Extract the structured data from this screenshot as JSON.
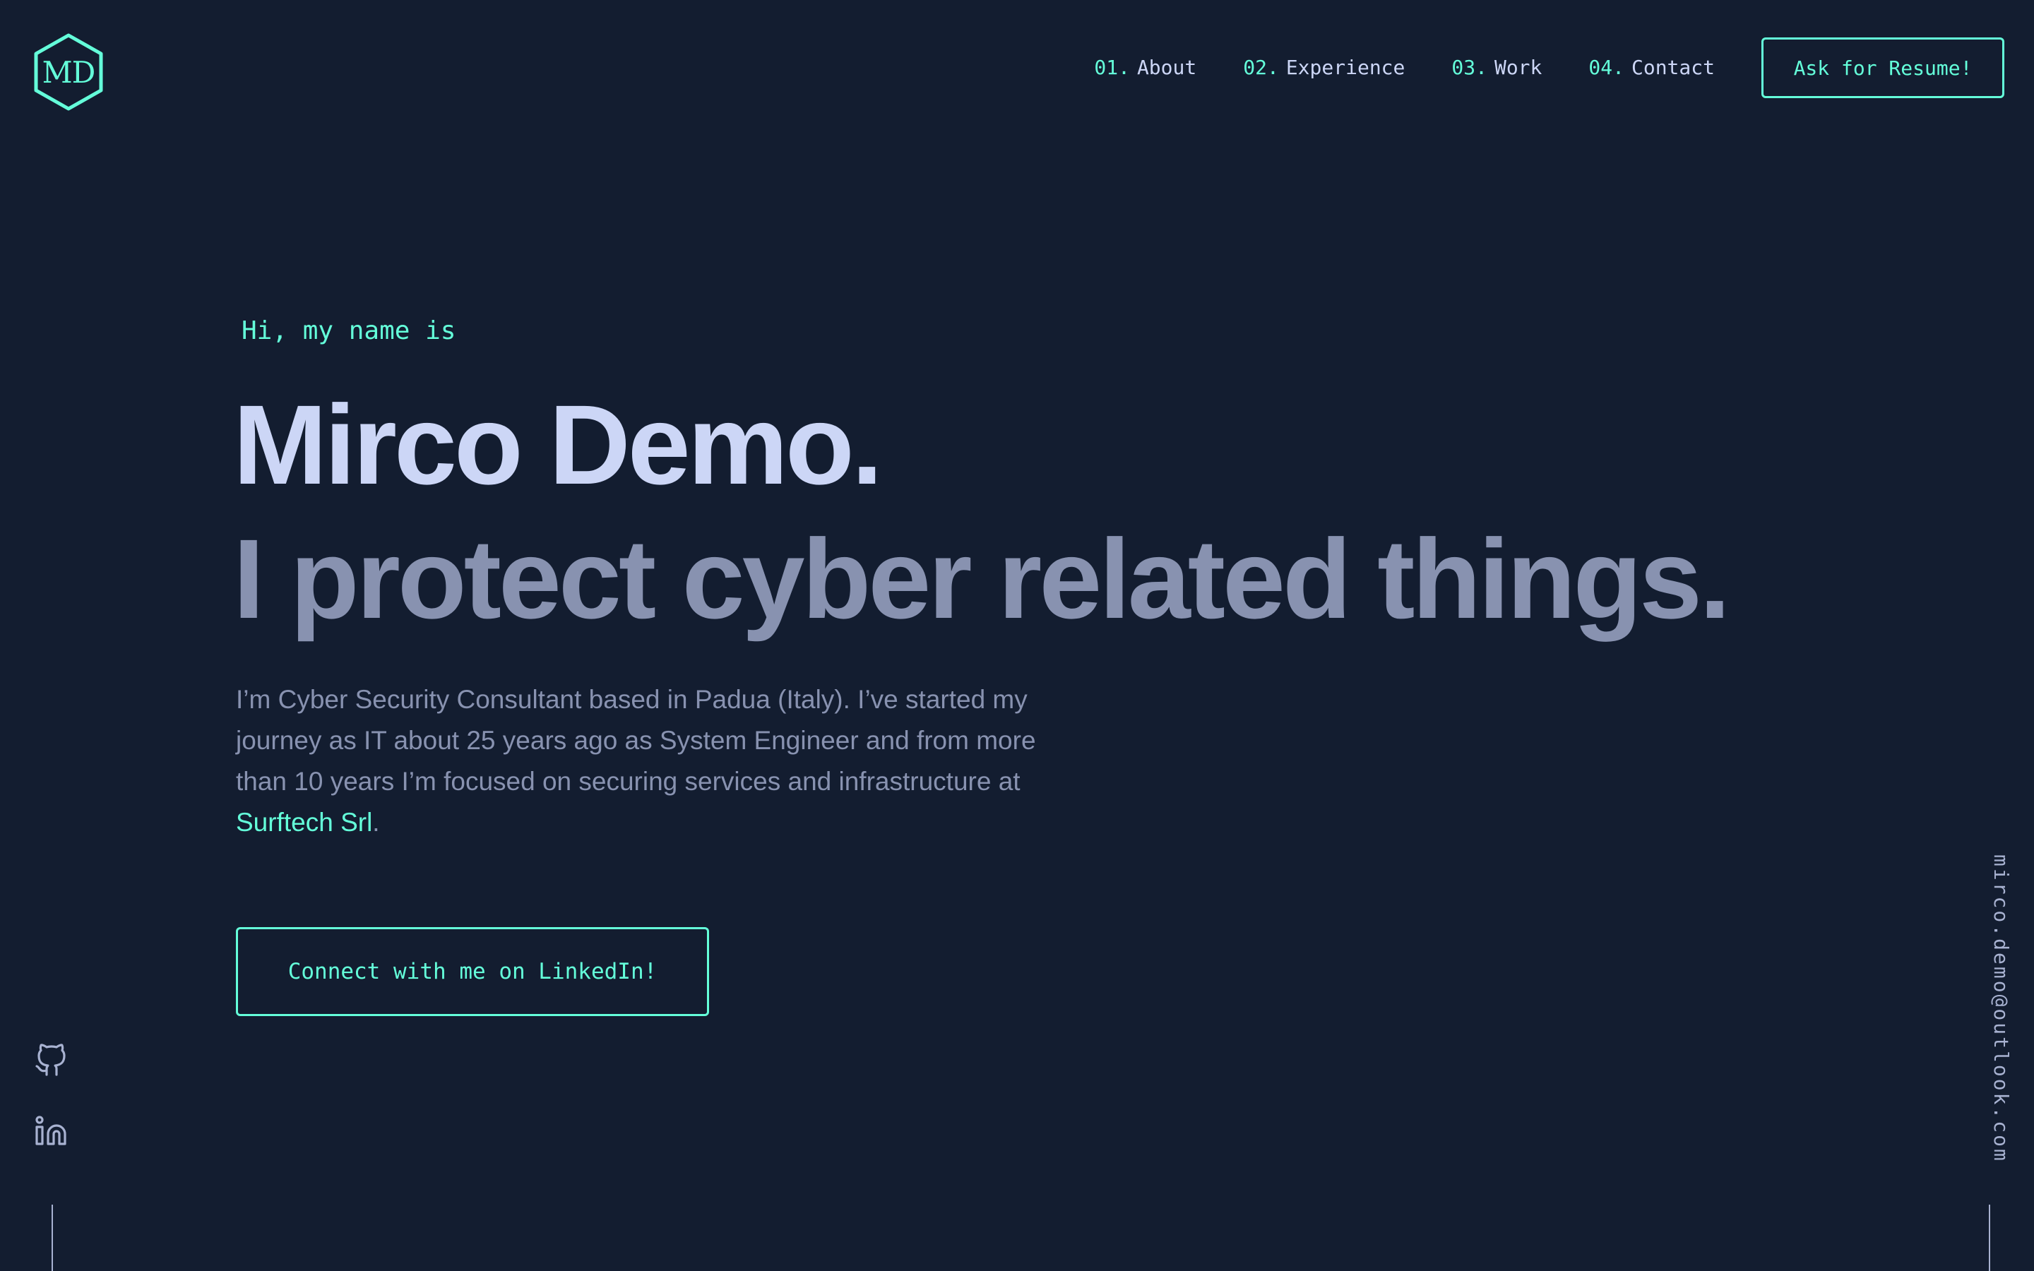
{
  "logo": {
    "initials": "MD",
    "color": "#64ffda"
  },
  "nav": {
    "items": [
      {
        "num": "01.",
        "label": "About"
      },
      {
        "num": "02.",
        "label": "Experience"
      },
      {
        "num": "03.",
        "label": "Work"
      },
      {
        "num": "04.",
        "label": "Contact"
      }
    ],
    "resume_label": "Ask for Resume!"
  },
  "hero": {
    "greeting": "Hi, my name is",
    "name": "Mirco Demo.",
    "tagline": "I protect cyber related things.",
    "bio_text": "I’m Cyber Security Consultant based in Padua (Italy). I’ve started my journey as IT about 25 years ago as System Engineer and from more than 10 years I’m focused on securing services and infrastructure at ",
    "bio_link": "Surftech Srl",
    "bio_end": ".",
    "cta_label": "Connect with me on LinkedIn!"
  },
  "social": {
    "icons": [
      "github-icon",
      "linkedin-icon"
    ]
  },
  "email": "mirco.demo@outlook.com",
  "colors": {
    "background": "#131d30",
    "accent": "#64ffda",
    "heading": "#ccd6f6",
    "text": "#8892b0"
  }
}
